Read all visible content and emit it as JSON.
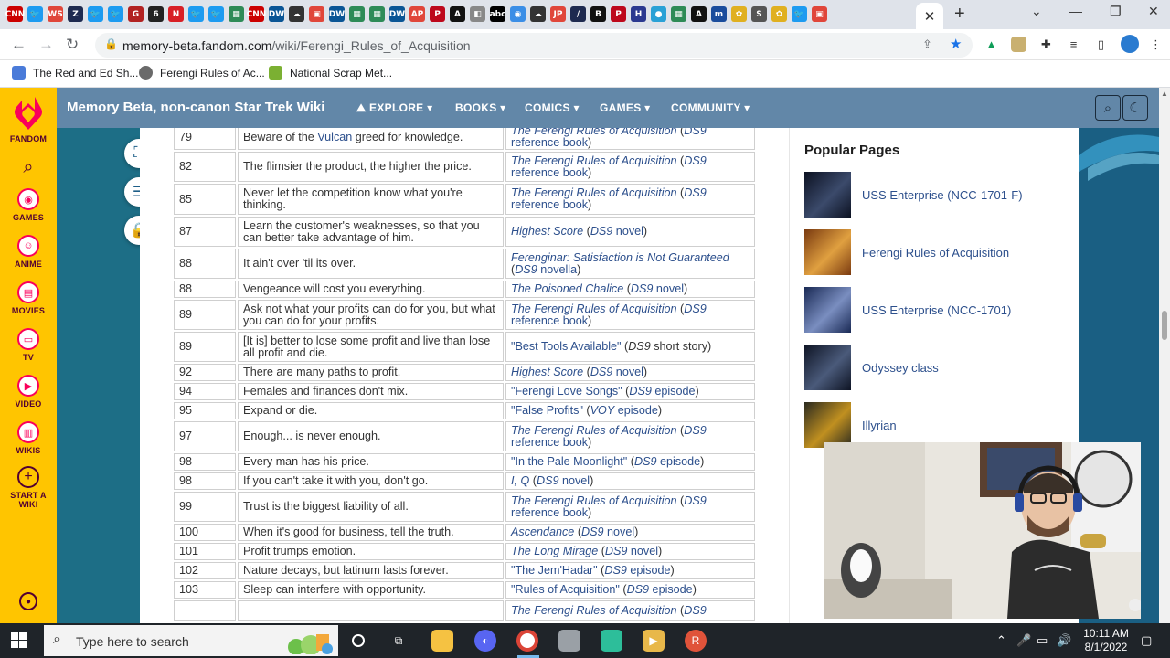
{
  "browser": {
    "url_host": "memory-beta.fandom.com",
    "url_path": "/wiki/Ferengi_Rules_of_Acquisition",
    "bookmarks": [
      {
        "label": "The Red and Ed Sh...",
        "color": "#4a7bd9"
      },
      {
        "label": "Ferengi Rules of Ac...",
        "color": "#6a6a6a"
      },
      {
        "label": "National Scrap Met...",
        "color": "#7bb032"
      }
    ],
    "tab_favicons": [
      {
        "t": "CNN",
        "c": "#cc0000"
      },
      {
        "t": "🐦",
        "c": "#1d9bf0"
      },
      {
        "t": "WS",
        "c": "#e0463a"
      },
      {
        "t": "Z",
        "c": "#1e2a50"
      },
      {
        "t": "🐦",
        "c": "#1d9bf0"
      },
      {
        "t": "🐦",
        "c": "#1d9bf0"
      },
      {
        "t": "G",
        "c": "#b22222"
      },
      {
        "t": "6",
        "c": "#222"
      },
      {
        "t": "N",
        "c": "#d81f26"
      },
      {
        "t": "🐦",
        "c": "#1d9bf0"
      },
      {
        "t": "🐦",
        "c": "#1d9bf0"
      },
      {
        "t": "▦",
        "c": "#2e8b57"
      },
      {
        "t": "CNN",
        "c": "#cc0000"
      },
      {
        "t": "DW",
        "c": "#0a5595"
      },
      {
        "t": "☁",
        "c": "#333"
      },
      {
        "t": "▣",
        "c": "#e0463a"
      },
      {
        "t": "DW",
        "c": "#0a5595"
      },
      {
        "t": "▦",
        "c": "#2e8b57"
      },
      {
        "t": "▦",
        "c": "#2e8b57"
      },
      {
        "t": "DW",
        "c": "#0a5595"
      },
      {
        "t": "AP",
        "c": "#e0463a"
      },
      {
        "t": "P",
        "c": "#bd081c"
      },
      {
        "t": "A",
        "c": "#111"
      },
      {
        "t": "◧",
        "c": "#888"
      },
      {
        "t": "abc",
        "c": "#000"
      },
      {
        "t": "◉",
        "c": "#3b8ee6"
      },
      {
        "t": "☁",
        "c": "#333"
      },
      {
        "t": "JP",
        "c": "#e0463a"
      },
      {
        "t": "/",
        "c": "#1e2a50"
      },
      {
        "t": "B",
        "c": "#111"
      },
      {
        "t": "P",
        "c": "#bd081c"
      },
      {
        "t": "H",
        "c": "#2b3990"
      },
      {
        "t": "●",
        "c": "#2aa1d6"
      },
      {
        "t": "▦",
        "c": "#2e8b57"
      },
      {
        "t": "A",
        "c": "#111"
      },
      {
        "t": "m",
        "c": "#1a4c9c"
      },
      {
        "t": "✿",
        "c": "#e0b020"
      },
      {
        "t": "S",
        "c": "#555"
      },
      {
        "t": "✿",
        "c": "#e0b020"
      },
      {
        "t": "🐦",
        "c": "#1d9bf0"
      },
      {
        "t": "▣",
        "c": "#e0463a"
      }
    ]
  },
  "rail": {
    "items": [
      {
        "label": "FANDOM",
        "icon": "fandom-heart-icon"
      },
      {
        "label": "",
        "icon": "search-icon"
      },
      {
        "label": "GAMES",
        "icon": "games-icon"
      },
      {
        "label": "ANIME",
        "icon": "anime-icon"
      },
      {
        "label": "MOVIES",
        "icon": "movies-icon"
      },
      {
        "label": "TV",
        "icon": "tv-icon"
      },
      {
        "label": "VIDEO",
        "icon": "video-icon"
      },
      {
        "label": "WIKIS",
        "icon": "wikis-icon"
      },
      {
        "label": "START A WIKI",
        "icon": "plus-icon"
      }
    ]
  },
  "wiki": {
    "name": "Memory Beta, non-canon Star Trek Wiki",
    "nav": [
      "EXPLORE",
      "BOOKS",
      "COMICS",
      "GAMES",
      "COMMUNITY"
    ]
  },
  "rules": [
    {
      "num": "79",
      "rule": [
        "Beware of the ",
        {
          "link": "Vulcan"
        },
        " greed for knowledge."
      ],
      "src": [
        {
          "i": "The Ferengi Rules of Acquisition"
        },
        {
          "t": " ("
        },
        {
          "i": "DS9"
        },
        {
          "t": " "
        },
        {
          "l": "reference book"
        },
        {
          "t": ")"
        }
      ]
    },
    {
      "num": "82",
      "rule": [
        "The flimsier the product, the higher the price."
      ],
      "src": [
        {
          "i": "The Ferengi Rules of Acquisition"
        },
        {
          "t": " ("
        },
        {
          "i": "DS9"
        },
        {
          "t": " "
        },
        {
          "l": "reference book"
        },
        {
          "t": ")"
        }
      ]
    },
    {
      "num": "85",
      "rule": [
        "Never let the competition know what you're thinking."
      ],
      "src": [
        {
          "i": "The Ferengi Rules of Acquisition"
        },
        {
          "t": " ("
        },
        {
          "i": "DS9"
        },
        {
          "t": " "
        },
        {
          "l": "reference book"
        },
        {
          "t": ")"
        }
      ]
    },
    {
      "num": "87",
      "rule": [
        "Learn the customer's weaknesses, so that you can better take advantage of him."
      ],
      "src": [
        {
          "i": "Highest Score"
        },
        {
          "t": " ("
        },
        {
          "i": "DS9"
        },
        {
          "l": " novel"
        },
        {
          "t": ")"
        }
      ]
    },
    {
      "num": "88",
      "rule": [
        "It ain't over 'til its over."
      ],
      "src": [
        {
          "i": "Ferenginar: Satisfaction is Not Guaranteed"
        },
        {
          "t": " ("
        },
        {
          "i": "DS9"
        },
        {
          "l": " novella"
        },
        {
          "t": ")"
        }
      ]
    },
    {
      "num": "88",
      "rule": [
        "Vengeance will cost you everything."
      ],
      "src": [
        {
          "i": "The Poisoned Chalice"
        },
        {
          "t": " ("
        },
        {
          "i": "DS9"
        },
        {
          "l": " novel"
        },
        {
          "t": ")"
        }
      ]
    },
    {
      "num": "89",
      "rule": [
        "Ask not what your profits can do for you, but what you can do for your profits."
      ],
      "src": [
        {
          "i": "The Ferengi Rules of Acquisition"
        },
        {
          "t": " ("
        },
        {
          "i": "DS9"
        },
        {
          "t": " "
        },
        {
          "l": "reference book"
        },
        {
          "t": ")"
        }
      ]
    },
    {
      "num": "89",
      "rule": [
        "[It is] better to lose some profit and live than lose all profit and die."
      ],
      "src": [
        {
          "l": "\"Best Tools Available\""
        },
        {
          "t": " ("
        },
        {
          "ti": "DS9"
        },
        {
          "t": " short story)"
        }
      ]
    },
    {
      "num": "92",
      "rule": [
        "There are many paths to profit."
      ],
      "src": [
        {
          "i": "Highest Score"
        },
        {
          "t": " ("
        },
        {
          "i": "DS9"
        },
        {
          "l": " novel"
        },
        {
          "t": ")"
        }
      ]
    },
    {
      "num": "94",
      "rule": [
        "Females and finances don't mix."
      ],
      "src": [
        {
          "l": "\"Ferengi Love Songs\""
        },
        {
          "t": " ("
        },
        {
          "i": "DS9"
        },
        {
          "l": " episode"
        },
        {
          "t": ")"
        }
      ]
    },
    {
      "num": "95",
      "rule": [
        "Expand or die."
      ],
      "src": [
        {
          "l": "\"False Profits\""
        },
        {
          "t": " ("
        },
        {
          "i": "VOY"
        },
        {
          "l": " episode"
        },
        {
          "t": ")"
        }
      ]
    },
    {
      "num": "97",
      "rule": [
        "Enough... is never enough."
      ],
      "src": [
        {
          "i": "The Ferengi Rules of Acquisition"
        },
        {
          "t": " ("
        },
        {
          "i": "DS9"
        },
        {
          "t": " "
        },
        {
          "l": "reference book"
        },
        {
          "t": ")"
        }
      ]
    },
    {
      "num": "98",
      "rule": [
        "Every man has his price."
      ],
      "src": [
        {
          "l": "\"In the Pale Moonlight\""
        },
        {
          "t": " ("
        },
        {
          "i": "DS9"
        },
        {
          "l": " episode"
        },
        {
          "t": ")"
        }
      ]
    },
    {
      "num": "98",
      "rule": [
        "If you can't take it with you, don't go."
      ],
      "src": [
        {
          "i": "I, Q"
        },
        {
          "t": " ("
        },
        {
          "i": "DS9"
        },
        {
          "l": " novel"
        },
        {
          "t": ")"
        }
      ]
    },
    {
      "num": "99",
      "rule": [
        "Trust is the biggest liability of all."
      ],
      "src": [
        {
          "i": "The Ferengi Rules of Acquisition"
        },
        {
          "t": " ("
        },
        {
          "i": "DS9"
        },
        {
          "t": " "
        },
        {
          "l": "reference book"
        },
        {
          "t": ")"
        }
      ]
    },
    {
      "num": "100",
      "rule": [
        "When it's good for business, tell the truth."
      ],
      "src": [
        {
          "i": "Ascendance"
        },
        {
          "t": " ("
        },
        {
          "i": "DS9"
        },
        {
          "l": " novel"
        },
        {
          "t": ")"
        }
      ]
    },
    {
      "num": "101",
      "rule": [
        "Profit trumps emotion."
      ],
      "src": [
        {
          "i": "The Long Mirage"
        },
        {
          "t": " ("
        },
        {
          "i": "DS9"
        },
        {
          "l": " novel"
        },
        {
          "t": ")"
        }
      ]
    },
    {
      "num": "102",
      "rule": [
        "Nature decays, but latinum lasts forever."
      ],
      "src": [
        {
          "l": "\"The Jem'Hadar\""
        },
        {
          "t": " ("
        },
        {
          "i": "DS9"
        },
        {
          "l": " episode"
        },
        {
          "t": ")"
        }
      ]
    },
    {
      "num": "103",
      "rule": [
        "Sleep can interfere with opportunity."
      ],
      "src": [
        {
          "l": "\"Rules of Acquisition\""
        },
        {
          "t": " ("
        },
        {
          "i": "DS9"
        },
        {
          "l": " episode"
        },
        {
          "t": ")"
        }
      ]
    },
    {
      "num": "",
      "rule": [
        ""
      ],
      "src": [
        {
          "i": "The Ferengi Rules of Acquisition"
        },
        {
          "t": " ("
        },
        {
          "i": "DS9"
        }
      ]
    }
  ],
  "popular": {
    "title": "Popular Pages",
    "items": [
      {
        "label": "USS Enterprise (NCC-1701-F)",
        "thumb": [
          "#0c1222",
          "#3b4a6b"
        ]
      },
      {
        "label": "Ferengi Rules of Acquisition",
        "thumb": [
          "#7a3a10",
          "#e0a040"
        ]
      },
      {
        "label": "USS Enterprise (NCC-1701)",
        "thumb": [
          "#1a2a55",
          "#7a8ec0"
        ]
      },
      {
        "label": "Odyssey class",
        "thumb": [
          "#0e1424",
          "#4a5a7a"
        ]
      },
      {
        "label": "Illyrian",
        "thumb": [
          "#2a2a20",
          "#c09020"
        ]
      }
    ]
  },
  "taskbar": {
    "search_placeholder": "Type here to search",
    "time": "10:11 AM",
    "date": "8/1/2022"
  }
}
